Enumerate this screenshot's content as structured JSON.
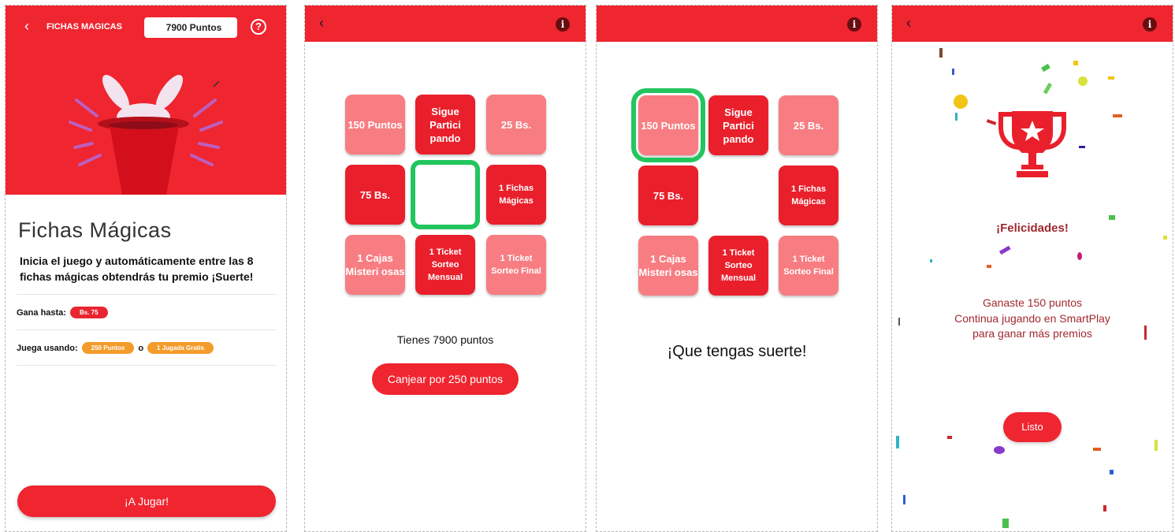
{
  "screen1": {
    "header_title": "FICHAS MAGICAS",
    "points_label": "7900 Puntos",
    "help_symbol": "?",
    "title": "Fichas Mágicas",
    "description": "Inicia el juego y automáticamente entre las 8 fichas mágicas obtendrás tu premio ¡Suerte!",
    "gana_label": "Gana hasta:",
    "gana_badge": "Bs. 75",
    "juega_label": "Juega usando:",
    "juega_badge_1": "250 Puntos",
    "juega_or": "o",
    "juega_badge_2": "1 Jugada Gratis",
    "play_button": "¡A Jugar!"
  },
  "tiles": {
    "t1": "150 Puntos",
    "t2": "Sigue Partici pando",
    "t3": "25 Bs.",
    "t4": "75 Bs.",
    "t6": "1 Fichas Mágicas",
    "t7": "1 Cajas Misteri osas",
    "t8": "1 Ticket Sorteo Mensual",
    "t9": "1 Ticket Sorteo Final"
  },
  "screen2": {
    "points_text": "Tienes 7900 puntos",
    "redeem_button": "Canjear por 250 puntos"
  },
  "screen3": {
    "luck_text": "¡Que tengas suerte!"
  },
  "screen4": {
    "congrats": "¡Felicidades!",
    "won_line1": "Ganaste 150 puntos",
    "won_line2": "Continua jugando en SmartPlay",
    "won_line3": "para ganar más premios",
    "done_button": "Listo"
  },
  "common": {
    "back_symbol": "‹",
    "info_symbol": "i"
  },
  "colors": {
    "brand_red": "#ef2530",
    "tile_light": "#f77d82",
    "tile_dark": "#e9202c",
    "selection_green": "#22c55e",
    "badge_orange": "#f49b2a",
    "text_dark_red": "#a12930"
  }
}
